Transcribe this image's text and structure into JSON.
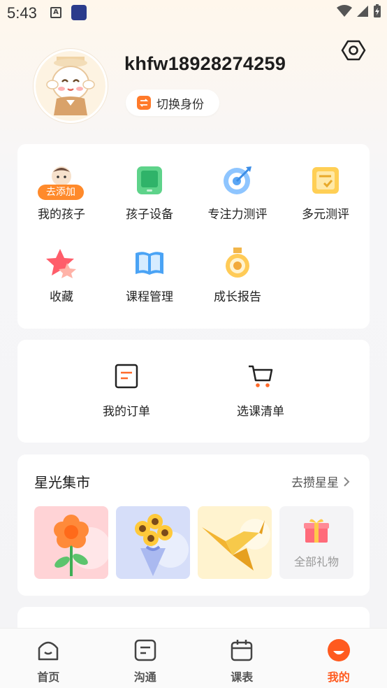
{
  "status_bar": {
    "time": "5:43"
  },
  "profile": {
    "username": "khfw18928274259",
    "switch_label": "切换身份"
  },
  "grid": {
    "add_badge": "去添加",
    "items": [
      {
        "label": "我的孩子",
        "icon": "child-icon"
      },
      {
        "label": "孩子设备",
        "icon": "tablet-icon"
      },
      {
        "label": "专注力测评",
        "icon": "target-icon"
      },
      {
        "label": "多元测评",
        "icon": "assessment-icon"
      },
      {
        "label": "收藏",
        "icon": "star-icon"
      },
      {
        "label": "课程管理",
        "icon": "book-icon"
      },
      {
        "label": "成长报告",
        "icon": "medal-icon"
      }
    ]
  },
  "orders": {
    "items": [
      {
        "label": "我的订单",
        "icon": "order-icon"
      },
      {
        "label": "选课清单",
        "icon": "cart-icon"
      }
    ]
  },
  "market": {
    "title": "星光集市",
    "link": "去攒星星",
    "all_gifts": "全部礼物"
  },
  "bottom_nav": {
    "items": [
      {
        "label": "首页",
        "icon": "home-icon"
      },
      {
        "label": "沟通",
        "icon": "chat-icon"
      },
      {
        "label": "课表",
        "icon": "calendar-icon"
      },
      {
        "label": "我的",
        "icon": "profile-icon"
      }
    ],
    "active": "我的"
  },
  "colors": {
    "accent": "#ff5a1f",
    "badge": "#ff8a2b"
  }
}
